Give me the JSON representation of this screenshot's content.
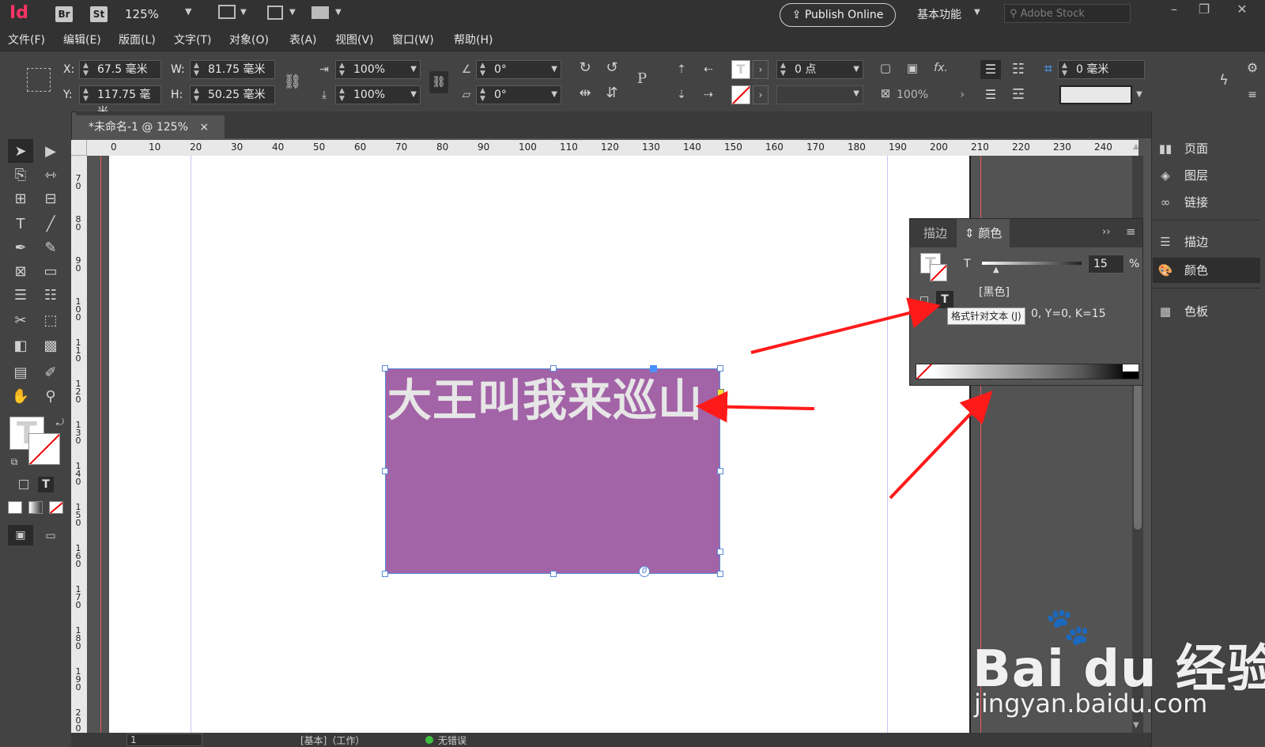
{
  "app": {
    "logo": "Id",
    "bridge_label": "Br",
    "stock_label": "St",
    "zoom": "125%",
    "publish_label": "Publish Online",
    "workspace": "基本功能",
    "search_placeholder": "Adobe Stock"
  },
  "menu": [
    "文件(F)",
    "编辑(E)",
    "版面(L)",
    "文字(T)",
    "对象(O)",
    "表(A)",
    "视图(V)",
    "窗口(W)",
    "帮助(H)"
  ],
  "control": {
    "x_label": "X:",
    "x_value": "67.5 毫米",
    "y_label": "Y:",
    "y_value": "117.75 毫米",
    "w_label": "W:",
    "w_value": "81.75 毫米",
    "h_label": "H:",
    "h_value": "50.25 毫米",
    "scale_x": "100%",
    "scale_y": "100%",
    "rotate": "0°",
    "shear": "0°",
    "stroke_weight": "0 点",
    "opacity": "100%",
    "offset": "0 毫米"
  },
  "tab": {
    "title": "*未命名-1 @ 125%",
    "close": "×"
  },
  "ruler": {
    "h_ticks": [
      "0",
      "10",
      "20",
      "30",
      "40",
      "50",
      "60",
      "70",
      "80",
      "90",
      "100",
      "110",
      "120",
      "130",
      "140",
      "150",
      "160",
      "170",
      "180",
      "190",
      "200",
      "210",
      "220",
      "230",
      "240"
    ],
    "v_ticks": [
      "7\n0",
      "8\n0",
      "9\n0",
      "1\n0\n0",
      "1\n1\n0",
      "1\n2\n0",
      "1\n3\n0",
      "1\n4\n0",
      "1\n5\n0",
      "1\n6\n0",
      "1\n7\n0",
      "1\n8\n0",
      "1\n9\n0",
      "2\n0\n0"
    ]
  },
  "frame": {
    "text": "大王叫我来巡山",
    "fill": "#a363a7"
  },
  "dock": {
    "items": [
      {
        "icon": "page-icon",
        "label": "页面"
      },
      {
        "icon": "layers-icon",
        "label": "图层"
      },
      {
        "icon": "links-icon",
        "label": "链接"
      },
      {
        "icon": "stroke-icon",
        "label": "描边"
      },
      {
        "icon": "color-icon",
        "label": "颜色"
      },
      {
        "icon": "swatches-icon",
        "label": "色板"
      }
    ]
  },
  "color_panel": {
    "tab_stroke": "描边",
    "tab_color": "颜色",
    "tint_label": "T",
    "tint_value": "15",
    "tint_unit": "%",
    "swatch_name": "[黑色]",
    "format_text_label": "T",
    "cmyk_readout": "0, Y=0, K=15",
    "tooltip": "格式针对文本 (J)"
  },
  "status": {
    "page": "1",
    "style": "[基本]（工作）",
    "preflight": "无错误"
  },
  "watermark": {
    "brand": "Bai du 经验",
    "url": "jingyan.baidu.com"
  },
  "colors": {
    "accent_red": "#ff1a1a",
    "frame_purple": "#a363a7"
  }
}
